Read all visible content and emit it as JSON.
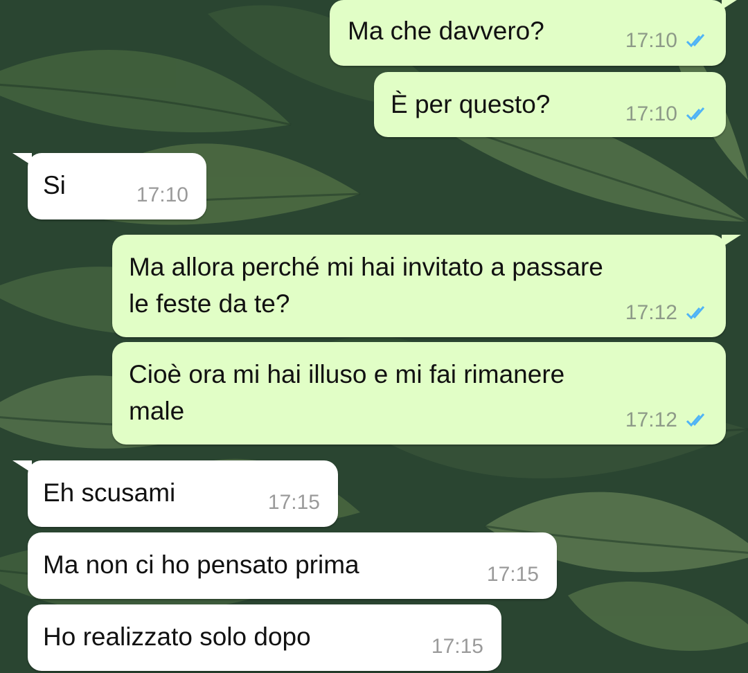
{
  "chat": {
    "messages": [
      {
        "direction": "out",
        "text": "Ma che davvero?",
        "time": "17:10",
        "status": "read"
      },
      {
        "direction": "out",
        "text": "È per questo?",
        "time": "17:10",
        "status": "read"
      },
      {
        "direction": "in",
        "text": "Si",
        "time": "17:10"
      },
      {
        "direction": "out",
        "text": "Ma allora perché mi hai invitato a passare\nle feste da te?",
        "time": "17:12",
        "status": "read"
      },
      {
        "direction": "out",
        "text": "Cioè ora mi hai illuso e mi fai rimanere\nmale",
        "time": "17:12",
        "status": "read"
      },
      {
        "direction": "in",
        "text": "Eh scusami",
        "time": "17:15"
      },
      {
        "direction": "in",
        "text": "Ma non ci ho pensato prima",
        "time": "17:15"
      },
      {
        "direction": "in",
        "text": "Ho realizzato solo dopo",
        "time": "17:15"
      }
    ]
  },
  "theme": {
    "outgoing_bubble": "#e1fec6",
    "incoming_bubble": "#ffffff",
    "read_tick_color": "#4fb3f6",
    "wallpaper_base": "#2e4d35"
  },
  "icons": {
    "read_status": "double-check-icon"
  }
}
